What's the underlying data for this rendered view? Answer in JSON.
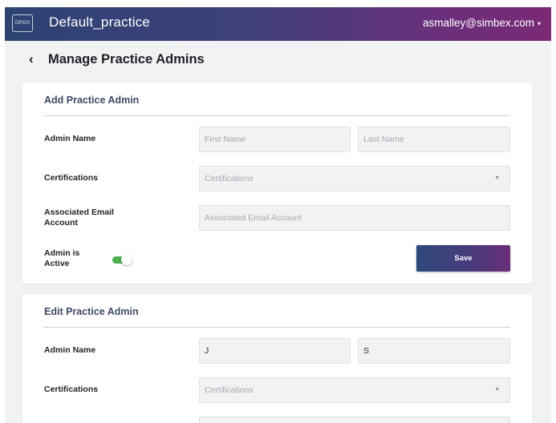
{
  "header": {
    "logo_text": "OPOS",
    "app_title": "Default_practice",
    "user_email": "asmalley@simbex.com",
    "user_menu_caret": "▾"
  },
  "page": {
    "back_glyph": "‹",
    "title": "Manage Practice Admins"
  },
  "add_admin": {
    "title": "Add Practice Admin",
    "admin_name_label": "Admin Name",
    "first_name_placeholder": "First Name",
    "last_name_placeholder": "Last Name",
    "certifications_label": "Certifications",
    "certifications_placeholder": "Certifications",
    "email_label_line1": "Associated Email",
    "email_label_line2": "Account",
    "email_placeholder": "Associated Email Account",
    "active_label_line1": "Admin is",
    "active_label_line2": "Active",
    "active_toggle_on": true,
    "save_label": "Save"
  },
  "edit_admin": {
    "title": "Edit Practice Admin",
    "admin_name_label": "Admin Name",
    "first_name_value": "J",
    "last_name_value": "S",
    "certifications_label": "Certifications",
    "certifications_placeholder": "Certifications"
  },
  "icons": {
    "dropdown": "chevron-down-icon",
    "back": "back-arrow-icon",
    "user_menu": "caret-down-icon"
  },
  "colors": {
    "header_gradient_start": "#2c4372",
    "header_gradient_end": "#7a2a74",
    "toggle_on": "#4caf50",
    "card_title": "#3d4a66",
    "page_background": "#f1f2f4"
  }
}
